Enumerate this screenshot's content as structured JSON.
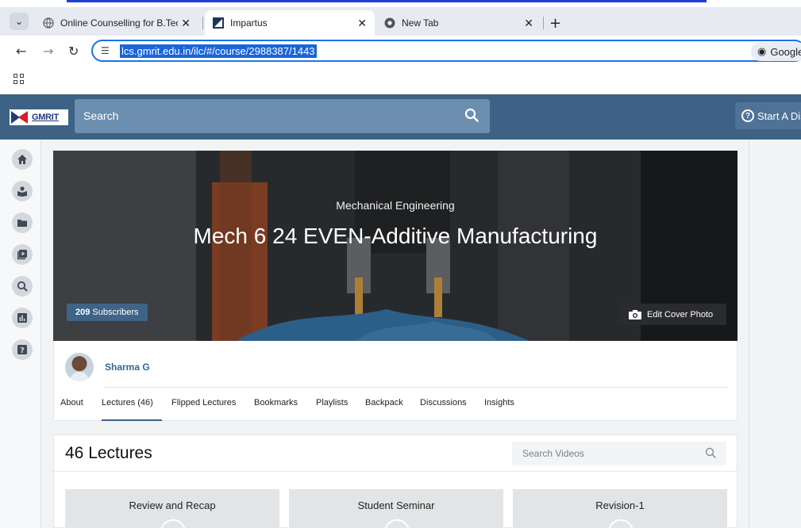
{
  "browser": {
    "tabs": [
      {
        "title": "Online Counselling for B.Tech. A",
        "active": false
      },
      {
        "title": "Impartus",
        "active": true
      },
      {
        "title": "New Tab",
        "active": false
      }
    ],
    "url": "lcs.gmrit.edu.in/ilc/#/course/2988387/1443",
    "lens_label": "Google"
  },
  "header": {
    "logo_text": "GMRIT",
    "search_placeholder": "Search",
    "start_discussion_label": "Start A Dis"
  },
  "course": {
    "subject": "Mechanical Engineering",
    "title": "Mech 6 24 EVEN-Additive Manufacturing",
    "subscribers_count": "209",
    "subscribers_label": "Subscribers",
    "edit_cover_label": "Edit Cover Photo",
    "instructor": "Sharma G",
    "tabs": [
      "About",
      "Lectures (46)",
      "Flipped Lectures",
      "Bookmarks",
      "Playlists",
      "Backpack",
      "Discussions",
      "Insights"
    ],
    "active_tab": "Lectures (46)"
  },
  "lectures": {
    "heading": "46 Lectures",
    "search_placeholder": "Search Videos",
    "items": [
      "Review and Recap",
      "Student Seminar",
      "Revision-1"
    ]
  },
  "colors": {
    "header": "#3d6285",
    "search_bg": "#6c8eaf",
    "accent": "#3f6487",
    "url_highlight": "#1a64d8"
  }
}
